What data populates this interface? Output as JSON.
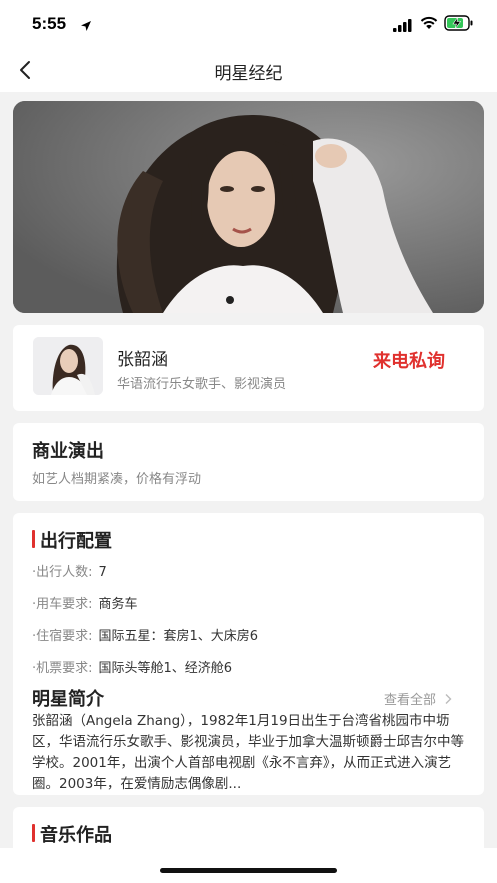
{
  "status": {
    "time": "5:55"
  },
  "nav": {
    "title": "明星经纪"
  },
  "artist": {
    "name": "张韶涵",
    "description": "华语流行乐女歌手、影视演员",
    "call_label": "来电私询"
  },
  "show": {
    "title": "商业演出",
    "subtitle": "如艺人档期紧凑，价格有浮动"
  },
  "config": {
    "title": "出行配置",
    "rows": [
      {
        "label": "·出行人数:",
        "value": "7"
      },
      {
        "label": "·用车要求:",
        "value": "商务车"
      },
      {
        "label": "·住宿要求:",
        "value": "国际五星：套房1、大床房6"
      },
      {
        "label": "·机票要求:",
        "value": "国际头等舱1、经济舱6"
      }
    ]
  },
  "intro": {
    "title": "明星简介",
    "view_all": "查看全部",
    "text": "张韶涵（Angela Zhang），1982年1月19日出生于台湾省桃园市中坜区，华语流行乐女歌手、影视演员，毕业于加拿大温斯顿爵士邱吉尔中等学校。2001年，出演个人首部电视剧《永不言弃》，从而正式进入演艺圈。2003年，在爱情励志偶像剧..."
  },
  "music": {
    "title": "音乐作品"
  },
  "colors": {
    "accent": "#e0312e",
    "background": "#f2f2f2"
  },
  "banner": {
    "active_index": 0
  }
}
